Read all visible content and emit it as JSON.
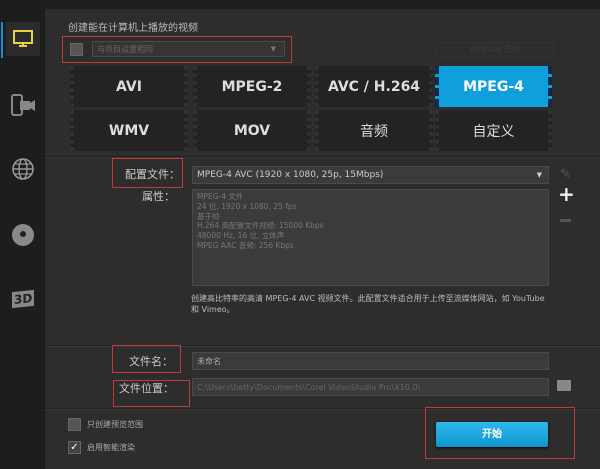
{
  "header": {
    "title": "创建能在计算机上播放的视频"
  },
  "project_settings": {
    "checked": false,
    "select_value": "与项目设置相同",
    "options_button": "MPEG-4 选项"
  },
  "formats": [
    {
      "label": "AVI"
    },
    {
      "label": "MPEG-2"
    },
    {
      "label": "AVC / H.264"
    },
    {
      "label": "MPEG-4",
      "selected": true
    },
    {
      "label": "WMV"
    },
    {
      "label": "MOV"
    },
    {
      "label": "音频"
    },
    {
      "label": "自定义"
    }
  ],
  "profile": {
    "label": "配置文件：",
    "value": "MPEG-4 AVC (1920 x 1080, 25p, 15Mbps)"
  },
  "properties": {
    "label": "属性：",
    "lines": [
      "MPEG-4 文件",
      "24 位, 1920 x 1080, 25 fps",
      "基于帧",
      "H.264 高配置文件视频: 15000 Kbps",
      "48000 Hz, 16 位, 立体声",
      "MPEG AAC 音频: 256 Kbps"
    ]
  },
  "description": "创建高比特率的高清 MPEG-4 AVC 视频文件。此配置文件适合用于上传至流媒体网站，如 YouTube 和 Vimeo。",
  "filename": {
    "label": "文件名：",
    "value": "未命名"
  },
  "location": {
    "label": "文件位置：",
    "value": "C:\\Users\\betty\\Documents\\Corel VideoStudio Pro\\X10.0\\"
  },
  "options": {
    "preview_range": {
      "label": "只创建预览范围",
      "checked": false
    },
    "smart_render": {
      "label": "启用智能渲染",
      "checked": true
    }
  },
  "start_button": "开始",
  "colors": {
    "accent": "#0fa0dc",
    "highlight": "#c0393b",
    "computer_icon": "#e8d24a"
  }
}
